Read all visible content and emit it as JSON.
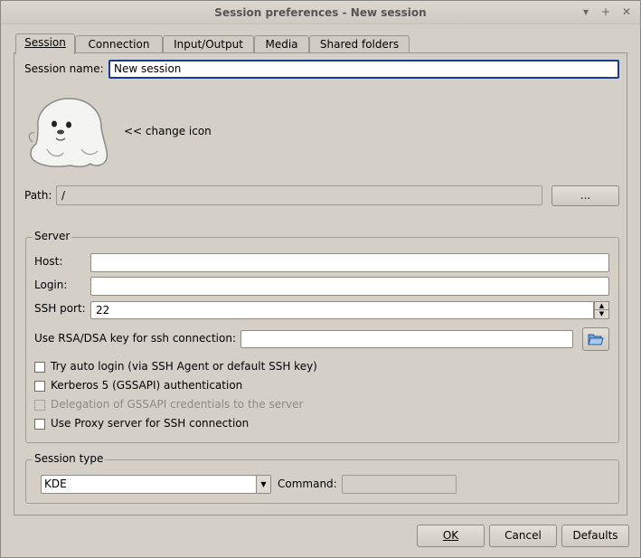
{
  "window": {
    "title": "Session preferences - New session"
  },
  "titlebar": {
    "menu_glyph": "▾",
    "plus_glyph": "+",
    "close_glyph": "✕"
  },
  "tabs": [
    {
      "label": "Session",
      "active": true
    },
    {
      "label": "Connection"
    },
    {
      "label": "Input/Output"
    },
    {
      "label": "Media"
    },
    {
      "label": "Shared folders"
    }
  ],
  "session": {
    "name_label": "Session name:",
    "name_value": "New session",
    "change_icon": "<< change icon",
    "path_label": "Path:",
    "path_value": "/",
    "path_button": "..."
  },
  "server": {
    "title": "Server",
    "host_label": "Host:",
    "host_value": "",
    "login_label": "Login:",
    "login_value": "",
    "ssh_port_label": "SSH port:",
    "ssh_port_value": "22",
    "rsa_label": "Use RSA/DSA key for ssh connection:",
    "rsa_value": "",
    "options": [
      {
        "label": "Try auto login (via SSH Agent or default SSH key)",
        "checked": false,
        "disabled": false
      },
      {
        "label": "Kerberos 5 (GSSAPI) authentication",
        "checked": false,
        "disabled": false
      },
      {
        "label": "Delegation of GSSAPI credentials to the server",
        "checked": false,
        "disabled": true
      },
      {
        "label": "Use Proxy server for SSH connection",
        "checked": false,
        "disabled": false
      }
    ]
  },
  "session_type": {
    "title": "Session type",
    "selected": "KDE",
    "command_label": "Command:",
    "command_value": ""
  },
  "footer": {
    "ok": "OK",
    "cancel": "Cancel",
    "defaults": "Defaults"
  },
  "icons": [
    "seal-icon",
    "folder-open-icon",
    "dropdown-arrow-icon",
    "spin-up-icon",
    "spin-down-icon"
  ]
}
